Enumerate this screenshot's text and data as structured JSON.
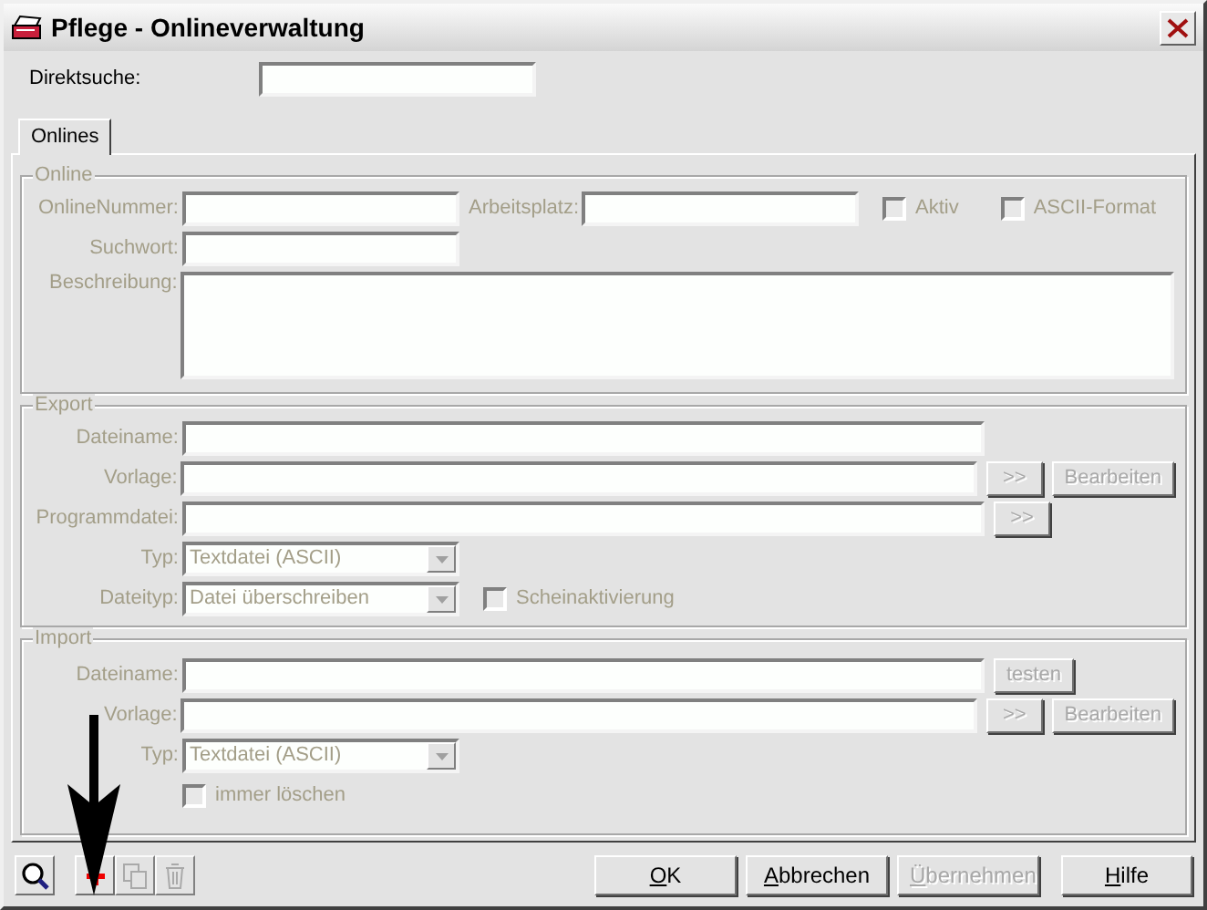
{
  "window": {
    "title": "Pflege - Onlineverwaltung"
  },
  "direct_search": {
    "label": "Direktsuche:"
  },
  "tabs": [
    {
      "label": "Onlines",
      "selected": true
    }
  ],
  "online": {
    "legend": "Online",
    "disabled": true,
    "online_number": {
      "label": "OnlineNummer:"
    },
    "workplace": {
      "label": "Arbeitsplatz:"
    },
    "active": {
      "label": "Aktiv",
      "checked": false
    },
    "ascii_format": {
      "label": "ASCII-Format",
      "checked": false
    },
    "keyword": {
      "label": "Suchwort:"
    },
    "description": {
      "label": "Beschreibung:"
    }
  },
  "export": {
    "legend": "Export",
    "disabled": true,
    "file_name": {
      "label": "Dateiname:"
    },
    "template": {
      "label": "Vorlage:",
      "buttons": [
        ">>",
        "Bearbeiten"
      ]
    },
    "program_file": {
      "label": "Programmdatei:",
      "buttons": [
        ">>"
      ]
    },
    "type": {
      "label": "Typ:",
      "value": "Textdatei (ASCII)"
    },
    "file_type": {
      "label": "Dateityp:",
      "value": "Datei überschreiben"
    },
    "fake_activation": {
      "label": "Scheinaktivierung",
      "checked": false
    }
  },
  "import": {
    "legend": "Import",
    "disabled": true,
    "file_name": {
      "label": "Dateiname:",
      "buttons": [
        "testen"
      ]
    },
    "template": {
      "label": "Vorlage:",
      "buttons": [
        ">>",
        "Bearbeiten"
      ]
    },
    "type": {
      "label": "Typ:",
      "value": "Textdatei (ASCII)"
    },
    "always_delete": {
      "label": "immer löschen",
      "checked": false
    }
  },
  "toolbar": [
    {
      "kind": "search",
      "disabled": false
    },
    {
      "kind": "new",
      "disabled": false
    },
    {
      "kind": "copy",
      "disabled": true
    },
    {
      "kind": "delete",
      "disabled": true
    }
  ],
  "buttons": [
    {
      "label": "OK",
      "disabled": false
    },
    {
      "label": "Abbrechen",
      "disabled": false
    },
    {
      "label": "Übernehmen",
      "disabled": true
    },
    {
      "label": "Hilfe",
      "disabled": false
    }
  ]
}
